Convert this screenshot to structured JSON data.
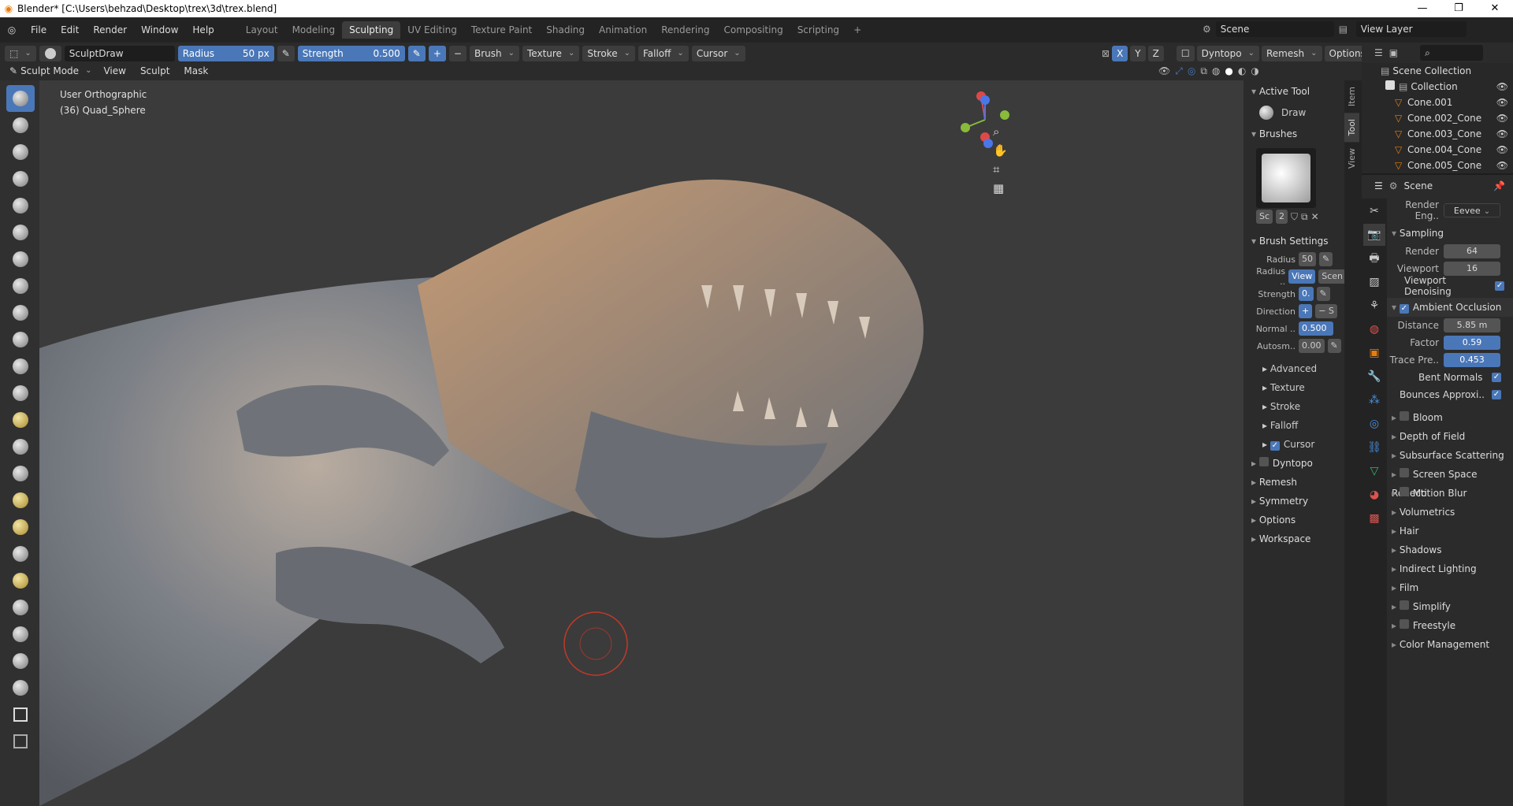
{
  "window": {
    "title": "Blender* [C:\\Users\\behzad\\Desktop\\trex\\3d\\trex.blend]",
    "controls": [
      "—",
      "❐",
      "✕"
    ]
  },
  "menu": [
    "File",
    "Edit",
    "Render",
    "Window",
    "Help"
  ],
  "workspaces": [
    "Layout",
    "Modeling",
    "Sculpting",
    "UV Editing",
    "Texture Paint",
    "Shading",
    "Animation",
    "Rendering",
    "Compositing",
    "Scripting"
  ],
  "add_tab": "+",
  "scene": {
    "label": "Scene",
    "view_layer": "View Layer"
  },
  "tool_header": {
    "brush_name": "SculptDraw",
    "radius_label": "Radius",
    "radius_value": "50 px",
    "strength_label": "Strength",
    "strength_value": "0.500",
    "plus": "+",
    "minus": "−",
    "menus": [
      "Brush",
      "Texture",
      "Stroke",
      "Falloff",
      "Cursor"
    ],
    "axes": [
      "X",
      "Y",
      "Z"
    ],
    "right_menus": [
      "Dyntopo",
      "Remesh",
      "Options"
    ]
  },
  "mode_header": {
    "mode": "Sculpt Mode",
    "menus": [
      "View",
      "Sculpt",
      "Mask"
    ]
  },
  "viewport": {
    "view_name": "User Orthographic",
    "object": "(36) Quad_Sphere",
    "gizmo_axes": [
      "X",
      "Y",
      "Z"
    ]
  },
  "npanel": {
    "tabs": [
      "Item",
      "Tool",
      "View"
    ],
    "active_tool_title": "Active Tool",
    "active_tool_name": "Draw",
    "brushes_title": "Brushes",
    "brush_slot": "Sc",
    "brush_users": "2",
    "brush_settings_title": "Brush Settings",
    "radius_label": "Radius",
    "radius_value": "50",
    "radius_unit_label": "Radius ..",
    "radius_unit_view": "View",
    "radius_unit_scene": "Scen",
    "strength_label": "Strength",
    "strength_value": "0.",
    "direction_label": "Direction",
    "direction_add": "+",
    "direction_sub": "− S",
    "normal_label": "Normal ..",
    "normal_value": "0.500",
    "autosmooth_label": "Autosm..",
    "autosmooth_value": "0.00",
    "subpanels": [
      "Advanced",
      "Texture",
      "Stroke",
      "Falloff",
      "Cursor"
    ],
    "sections": [
      "Dyntopo",
      "Remesh",
      "Symmetry",
      "Options",
      "Workspace"
    ]
  },
  "outliner": {
    "root": "Scene Collection",
    "collection": "Collection",
    "items": [
      "Cone.001",
      "Cone.002_Cone",
      "Cone.003_Cone",
      "Cone.004_Cone",
      "Cone.005_Cone"
    ]
  },
  "properties": {
    "context": "Scene",
    "render_engine_label": "Render Eng..",
    "render_engine_value": "Eevee",
    "sampling_title": "Sampling",
    "render_label": "Render",
    "render_value": "64",
    "viewport_label": "Viewport",
    "viewport_value": "16",
    "viewport_denoising": "Viewport Denoising",
    "ao_title": "Ambient Occlusion",
    "distance_label": "Distance",
    "distance_value": "5.85 m",
    "factor_label": "Factor",
    "factor_value": "0.59",
    "trace_label": "Trace Pre..",
    "trace_value": "0.453",
    "bent_normals": "Bent Normals",
    "bounces": "Bounces Approxi..",
    "sections": [
      {
        "label": "Bloom",
        "check": true
      },
      {
        "label": "Depth of Field",
        "check": false
      },
      {
        "label": "Subsurface Scattering",
        "check": false
      },
      {
        "label": "Screen Space Reflecti",
        "check": true
      },
      {
        "label": "Motion Blur",
        "check": true
      },
      {
        "label": "Volumetrics",
        "check": false
      },
      {
        "label": "Hair",
        "check": false
      },
      {
        "label": "Shadows",
        "check": false
      },
      {
        "label": "Indirect Lighting",
        "check": false
      },
      {
        "label": "Film",
        "check": false
      },
      {
        "label": "Simplify",
        "check": true
      },
      {
        "label": "Freestyle",
        "check": true
      },
      {
        "label": "Color Management",
        "check": false
      }
    ]
  },
  "colors": {
    "accent": "#4a77b8",
    "orange": "#e87d0d",
    "bg": "#303030"
  }
}
